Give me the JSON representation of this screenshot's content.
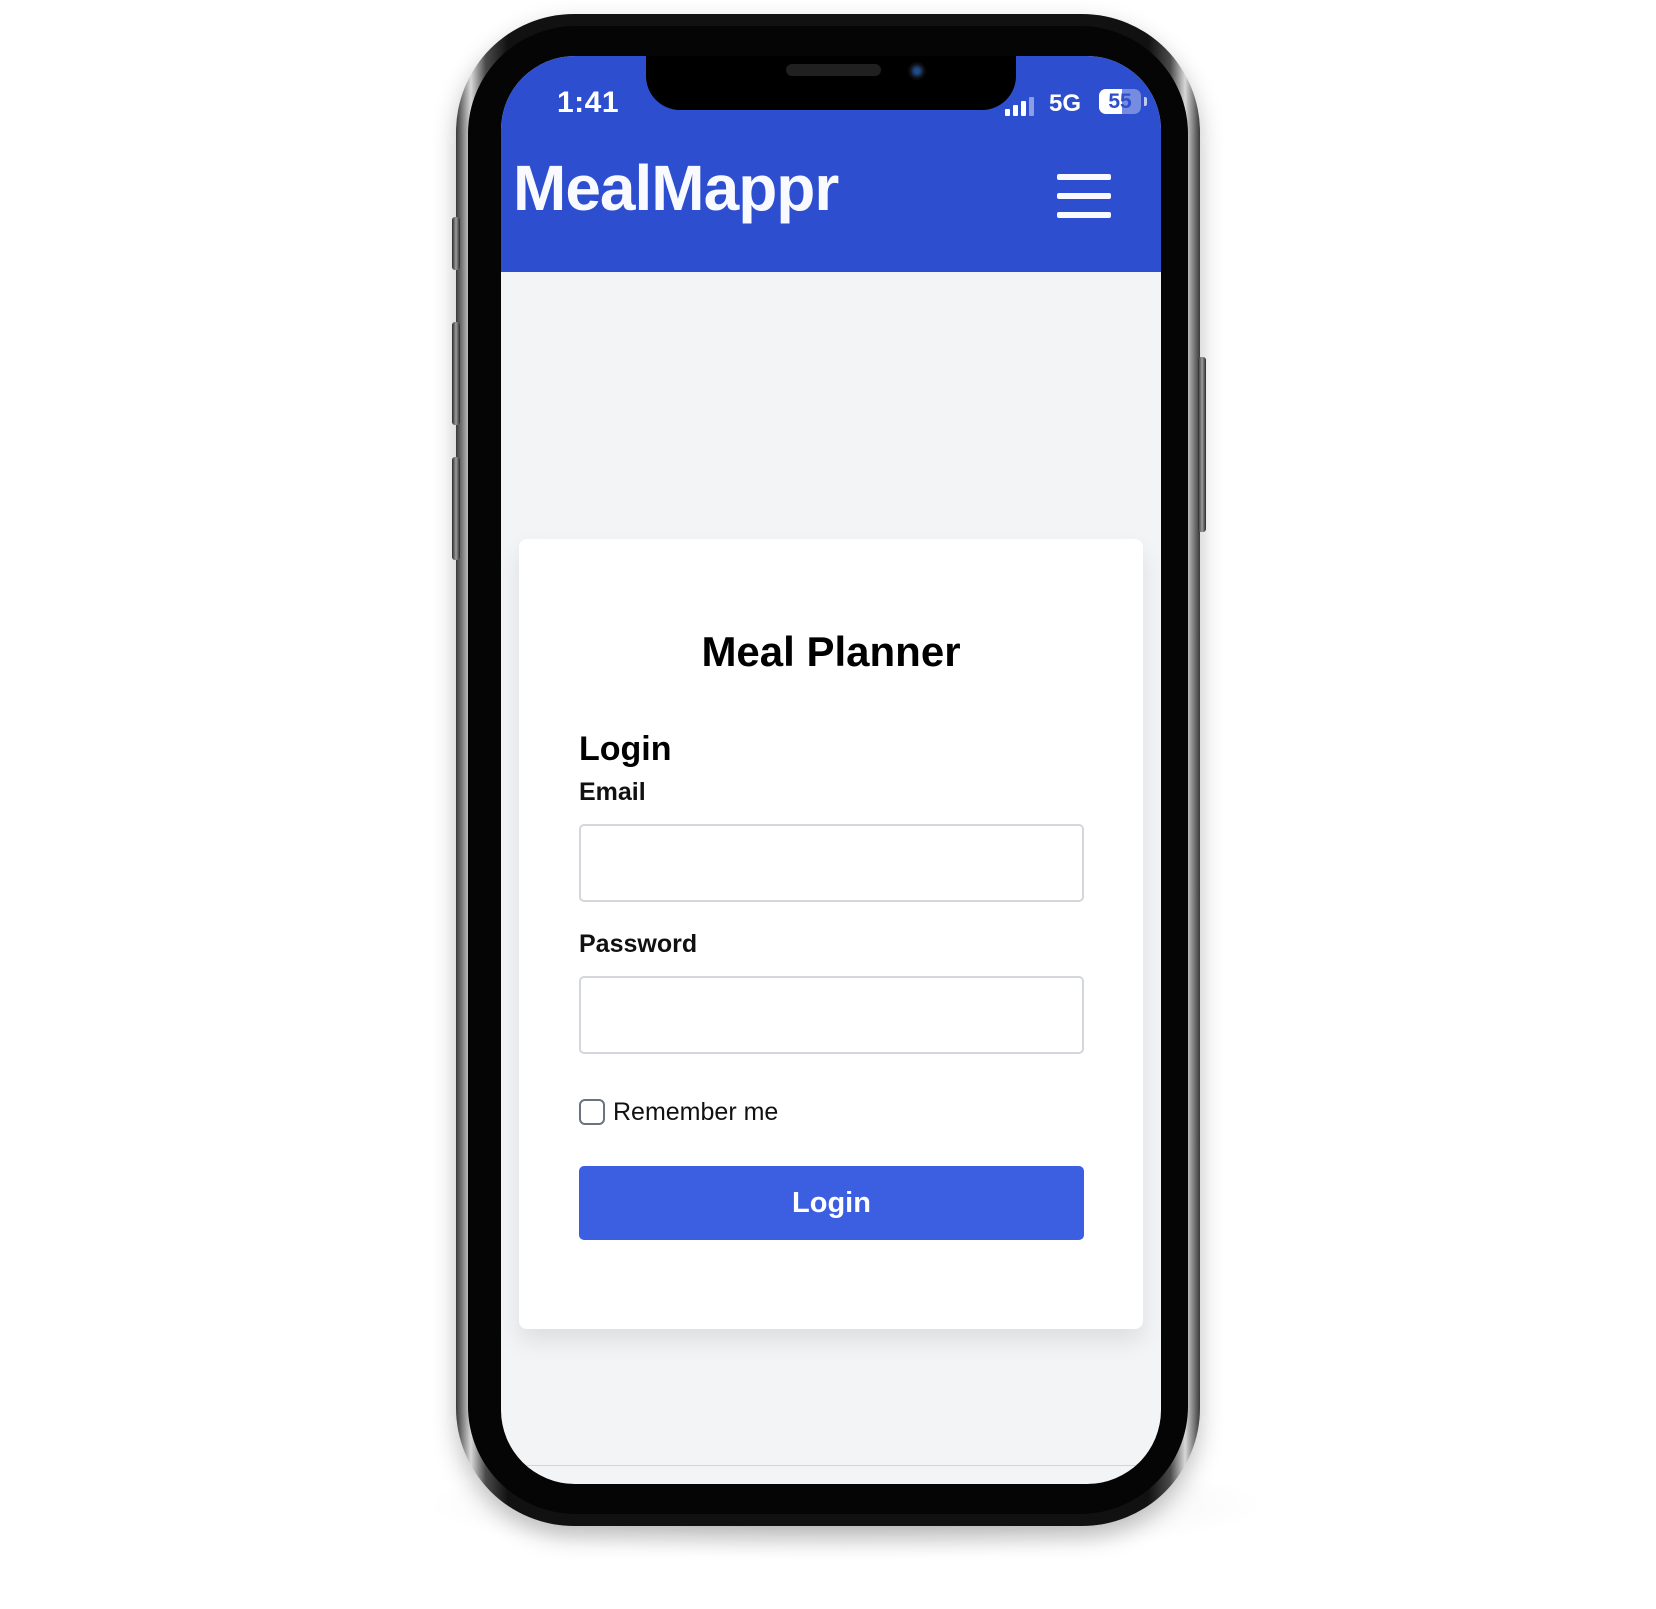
{
  "status_bar": {
    "time": "1:41",
    "network": "5G",
    "battery_level": "55",
    "signal_icon": "cellular-signal-icon",
    "battery_icon": "battery-icon"
  },
  "header": {
    "brand": "MealMappr",
    "menu_icon": "menu-icon",
    "background_color": "#2d4fcf"
  },
  "login_card": {
    "title": "Meal Planner",
    "section_title": "Login",
    "email_label": "Email",
    "email_value": "",
    "email_placeholder": "",
    "password_label": "Password",
    "password_value": "",
    "password_placeholder": "",
    "remember_label": "Remember me",
    "remember_checked": false,
    "login_button_label": "Login",
    "button_color": "#3b5fe0"
  }
}
